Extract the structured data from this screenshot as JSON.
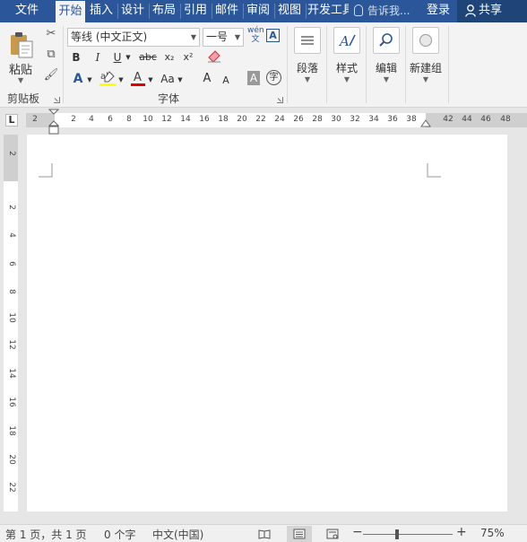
{
  "tabs": [
    {
      "label": "文件",
      "active": false
    },
    {
      "label": "开始",
      "active": true
    },
    {
      "label": "插入",
      "active": false
    },
    {
      "label": "设计",
      "active": false
    },
    {
      "label": "布局",
      "active": false
    },
    {
      "label": "引用",
      "active": false
    },
    {
      "label": "邮件",
      "active": false
    },
    {
      "label": "审阅",
      "active": false
    },
    {
      "label": "视图",
      "active": false
    },
    {
      "label": "开发工具",
      "active": false
    }
  ],
  "tell_me": "告诉我...",
  "login": "登录",
  "share": "共享",
  "ribbon": {
    "clipboard": {
      "paste": "粘贴",
      "group_label": "剪贴板"
    },
    "font": {
      "font_name": "等线 (中文正文)",
      "font_size": "一号",
      "group_label": "字体",
      "phonetic": "wén",
      "bold": "B",
      "italic": "I",
      "underline": "U",
      "strike": "abc",
      "subscript": "x₂",
      "superscript": "x²",
      "font_color_letter": "A",
      "change_case": "Aa",
      "grow": "A",
      "shrink": "A",
      "char_shading": "A",
      "enclose": "字",
      "char_border": "A"
    },
    "paragraph": {
      "label": "段落"
    },
    "styles": {
      "label": "样式"
    },
    "editing": {
      "label": "编辑"
    },
    "new_group": {
      "label": "新建组"
    }
  },
  "ruler": {
    "tab_selector": "L",
    "h_numbers": [
      "2",
      "2",
      "4",
      "6",
      "8",
      "10",
      "12",
      "14",
      "16",
      "18",
      "20",
      "22",
      "24",
      "26",
      "28",
      "30",
      "32",
      "34",
      "36",
      "38",
      "42",
      "44",
      "46",
      "48"
    ],
    "v_numbers": [
      "2",
      "2",
      "4",
      "6",
      "8",
      "10",
      "12",
      "14",
      "16",
      "18",
      "20",
      "22"
    ]
  },
  "status": {
    "page": "第 1 页，共 1 页",
    "words": "0 个字",
    "language": "中文(中国)",
    "zoom_minus": "−",
    "zoom_plus": "+",
    "zoom": "75%",
    "zoom_fraction": 0.375
  },
  "colors": {
    "brand": "#2b579a",
    "highlight": "#ffff00",
    "font_color": "#e00000"
  }
}
